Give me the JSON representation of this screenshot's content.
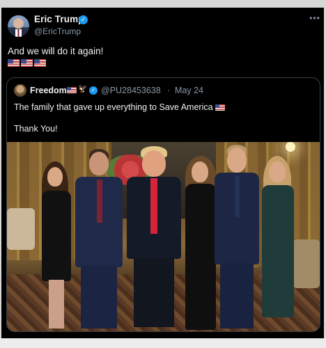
{
  "author": {
    "display_name": "Eric Trump",
    "handle": "@EricTrump",
    "verified": true
  },
  "tweet": {
    "text": "And we will do it again!",
    "flag_icons": [
      "us-flag-icon",
      "us-flag-icon",
      "us-flag-icon"
    ]
  },
  "more_icon_glyph": "•••",
  "quoted_tweet": {
    "display_name": "Freedom",
    "badges": [
      "us-flag-icon",
      "eagle-icon",
      "verified-icon"
    ],
    "handle": "@PU28453638",
    "separator": "·",
    "date": "May 24",
    "text": "The family that gave up everything to Save America",
    "text_flag_icon": "us-flag-icon",
    "second_text": "Thank You!"
  },
  "colors": {
    "background": "#000000",
    "text": "#e7e9ea",
    "muted": "#8b98a5",
    "verified": "#1d9bf0",
    "border": "#3a3f44"
  }
}
